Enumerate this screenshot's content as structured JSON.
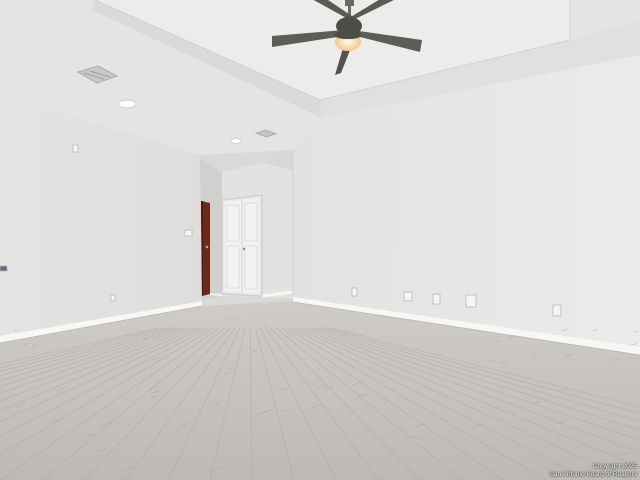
{
  "photo": {
    "subject": "empty room with light wood-look plank floor, white walls, tray ceiling with ceiling fan, white interior door and dark wood door in back hallway",
    "colors": {
      "ceiling": "#e6e6e4",
      "tray_inner": "#eeeeec",
      "wall_left": "#e3e3e1",
      "wall_right": "#e7e7e5",
      "wall_back": "#dcdcda",
      "floor_base": "#c9c6c2",
      "baseboard": "#f6f6f4",
      "door_white": "#f0f0ee",
      "door_dark": "#6a2a1a",
      "fan_blade": "#5c5a57",
      "fan_light": "#f3d89a"
    }
  },
  "watermark": {
    "line1": "Copyright 2025",
    "line2": "San Antonio Board of Realtors"
  }
}
